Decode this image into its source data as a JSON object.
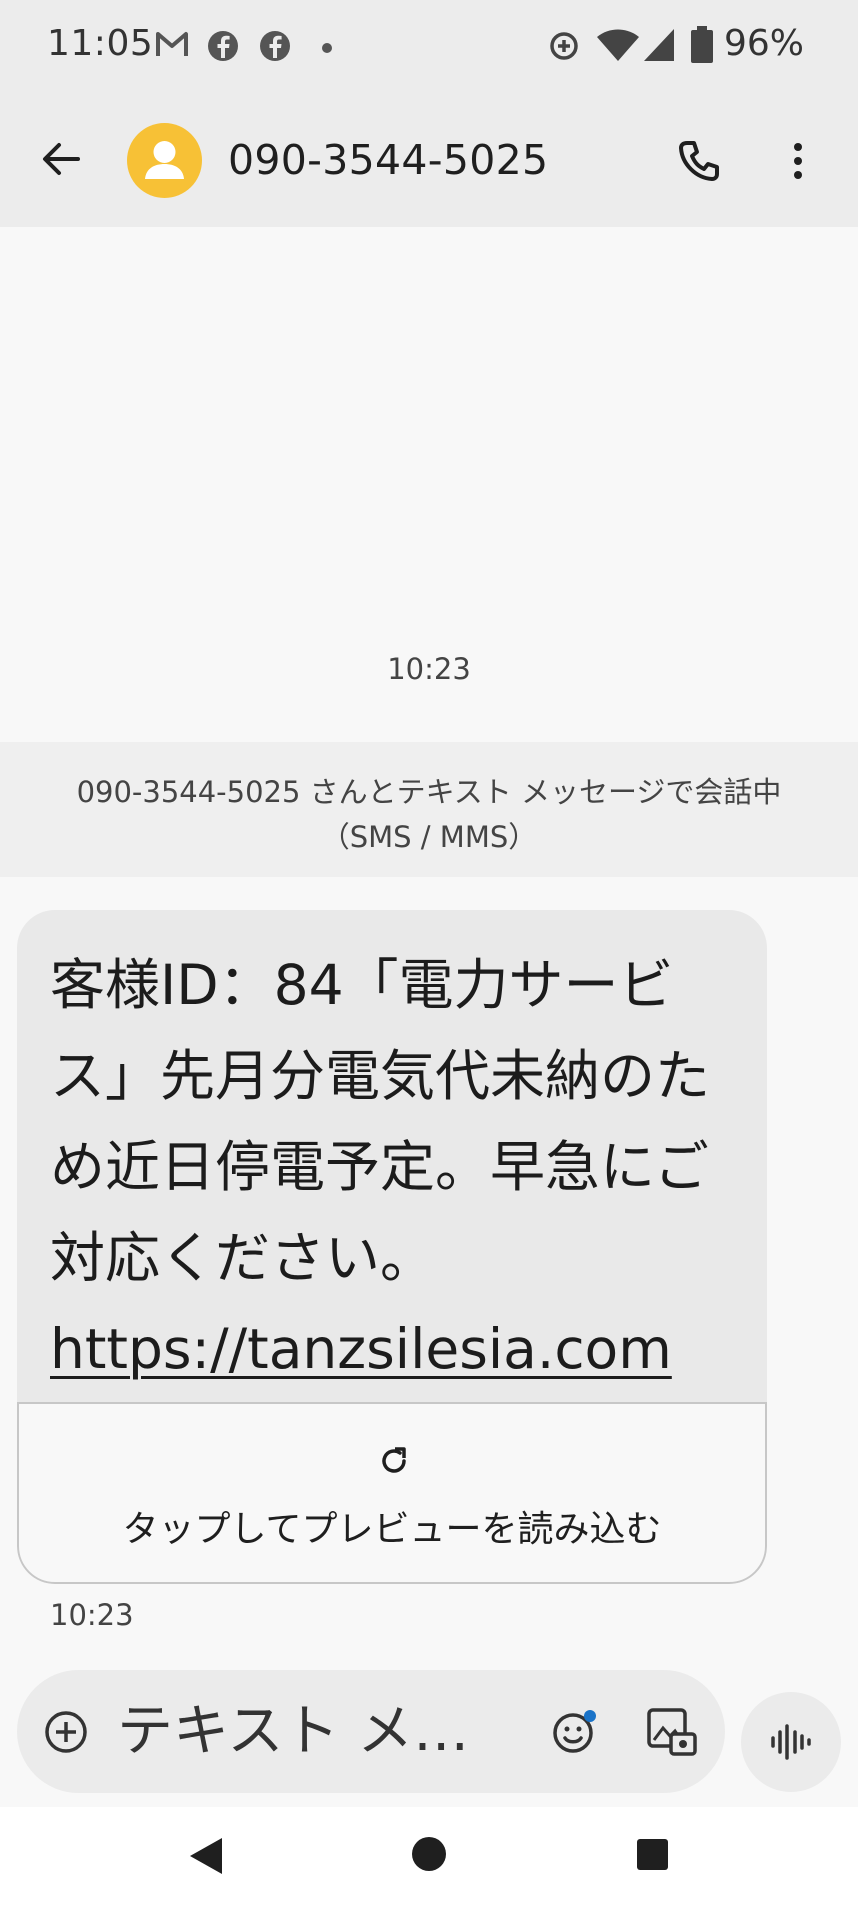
{
  "status_bar": {
    "time": "11:05",
    "battery_percent": "96%",
    "icons": [
      "gmail-icon",
      "facebook-icon",
      "facebook-icon",
      "dot-icon",
      "data-saver-icon",
      "wifi-icon",
      "signal-icon",
      "battery-icon"
    ]
  },
  "app_bar": {
    "contact": "090-3544-5025"
  },
  "thread": {
    "timestamp": "10:23",
    "info_banner": "090-3544-5025 さんとテキスト メッセージで会話中（SMS / MMS）"
  },
  "message": {
    "text": "客様ID：84「電力サービス」先月分電気代未納のため近日停電予定。早急にご対応ください。",
    "link": "https://tanzsilesia.com",
    "preview_label": "タップしてプレビューを読み込む",
    "time": "10:23"
  },
  "compose": {
    "placeholder": "テキスト メ…"
  },
  "colors": {
    "avatar": "#f7c136",
    "bar_background": "#ececec",
    "bubble": "#e9e9e9"
  }
}
